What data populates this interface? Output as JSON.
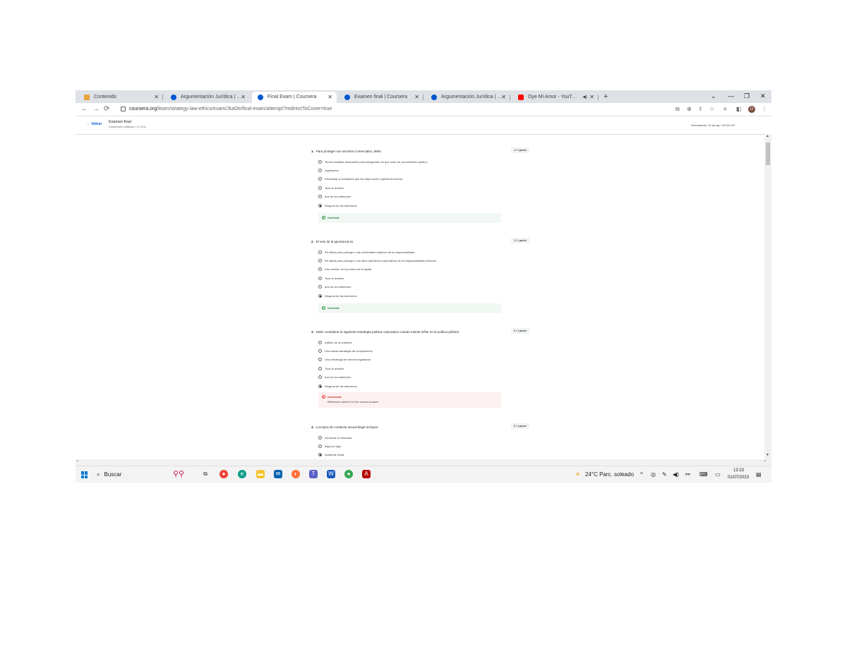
{
  "tabs": [
    {
      "label": "Contenido",
      "active": false,
      "icon": "coursera-orange-icon"
    },
    {
      "label": "Argumentación Jurídica | Coursera",
      "active": false,
      "icon": "coursera-icon"
    },
    {
      "label": "Final Exam | Coursera",
      "active": true,
      "icon": "coursera-icon"
    },
    {
      "label": "Examen final | Coursera",
      "active": false,
      "icon": "coursera-icon"
    },
    {
      "label": "Argumentación Jurídica | Coursera",
      "active": false,
      "icon": "coursera-icon"
    },
    {
      "label": "Oye Mi Amor - YouTube",
      "active": false,
      "icon": "youtube-icon"
    }
  ],
  "address": {
    "host": "coursera.org",
    "path": "/learn/strategy-law-ethics/exam/JkaOe/final-exam/attempt?redirectToCover=true"
  },
  "profile_initial": "D",
  "header": {
    "back_label": "Volver",
    "title": "Examen final",
    "subtitle": "Cuestionario Calificado • 1 h 15 m",
    "due": "Vencimiento: 10 de sep. 22:59 CST"
  },
  "questions": [
    {
      "number": "1.",
      "text": "Para proteger sus secretos comerciales, debe:",
      "points": "1 / 1 punto",
      "options": [
        {
          "label": "Tomar medidas razonables para asegurarse de que sean de conocimiento público.",
          "selected": false
        },
        {
          "label": "registrarlos",
          "selected": false
        },
        {
          "label": "Demandar a cualquiera que les haya hecho ingeniería inversa",
          "selected": false
        },
        {
          "label": "Todo lo anterior",
          "selected": false
        },
        {
          "label": "dos de los anteriores",
          "selected": false
        },
        {
          "label": "Ninguna de las anteriores",
          "selected": true
        }
      ],
      "feedback": {
        "status": "correct",
        "label": "Correcto",
        "detail": ""
      }
    },
    {
      "number": "2.",
      "text": "El velo de la ignorancia es",
      "points": "1 / 1 punto",
      "options": [
        {
          "label": "Se utiliza para proteger a las sociedades matrices de la responsabilidad",
          "selected": false
        },
        {
          "label": "Se utiliza para proteger a los altos ejecutivos corporativos de la responsabilidad personal",
          "selected": false
        },
        {
          "label": "Una versión de la prueba de la lápida",
          "selected": false
        },
        {
          "label": "Todo lo anterior",
          "selected": false
        },
        {
          "label": "dos de los anteriores",
          "selected": false
        },
        {
          "label": "Ninguna de las anteriores",
          "selected": true
        }
      ],
      "feedback": {
        "status": "correct",
        "label": "Correcto",
        "detail": ""
      }
    },
    {
      "number": "3.",
      "text": "Debe considerar la siguiente estrategia política corporativa cuando intente influir en la política pública:",
      "points": "0 / 1 punto",
      "options": [
        {
          "label": "edificio de la coalición",
          "selected": false
        },
        {
          "label": "Una sólida estrategia de cumplimiento",
          "selected": false
        },
        {
          "label": "Una estrategia de brecha regulatoria",
          "selected": false
        },
        {
          "label": "Todo lo anterior",
          "selected": false
        },
        {
          "label": "dos de los anteriores",
          "selected": false
        },
        {
          "label": "Ninguna de las anteriores",
          "selected": true
        }
      ],
      "feedback": {
        "status": "incorrect",
        "label": "Incorrecto",
        "detail": "Reference week 5 for the correct answer"
      }
    },
    {
      "number": "4.",
      "text": "Los tipos de conducta sexual ilegal incluyen:",
      "points": "0 / 1 punto",
      "options": [
        {
          "label": "conducta no deseada",
          "selected": false
        },
        {
          "label": "Algo por algo",
          "selected": false
        },
        {
          "label": "Ambiente hostil",
          "selected": true
        }
      ],
      "feedback": null
    }
  ],
  "taskbar": {
    "search_placeholder": "Buscar",
    "weather": "24°C  Parc. soleado",
    "time": "13:23",
    "date": "01/07/2023"
  }
}
